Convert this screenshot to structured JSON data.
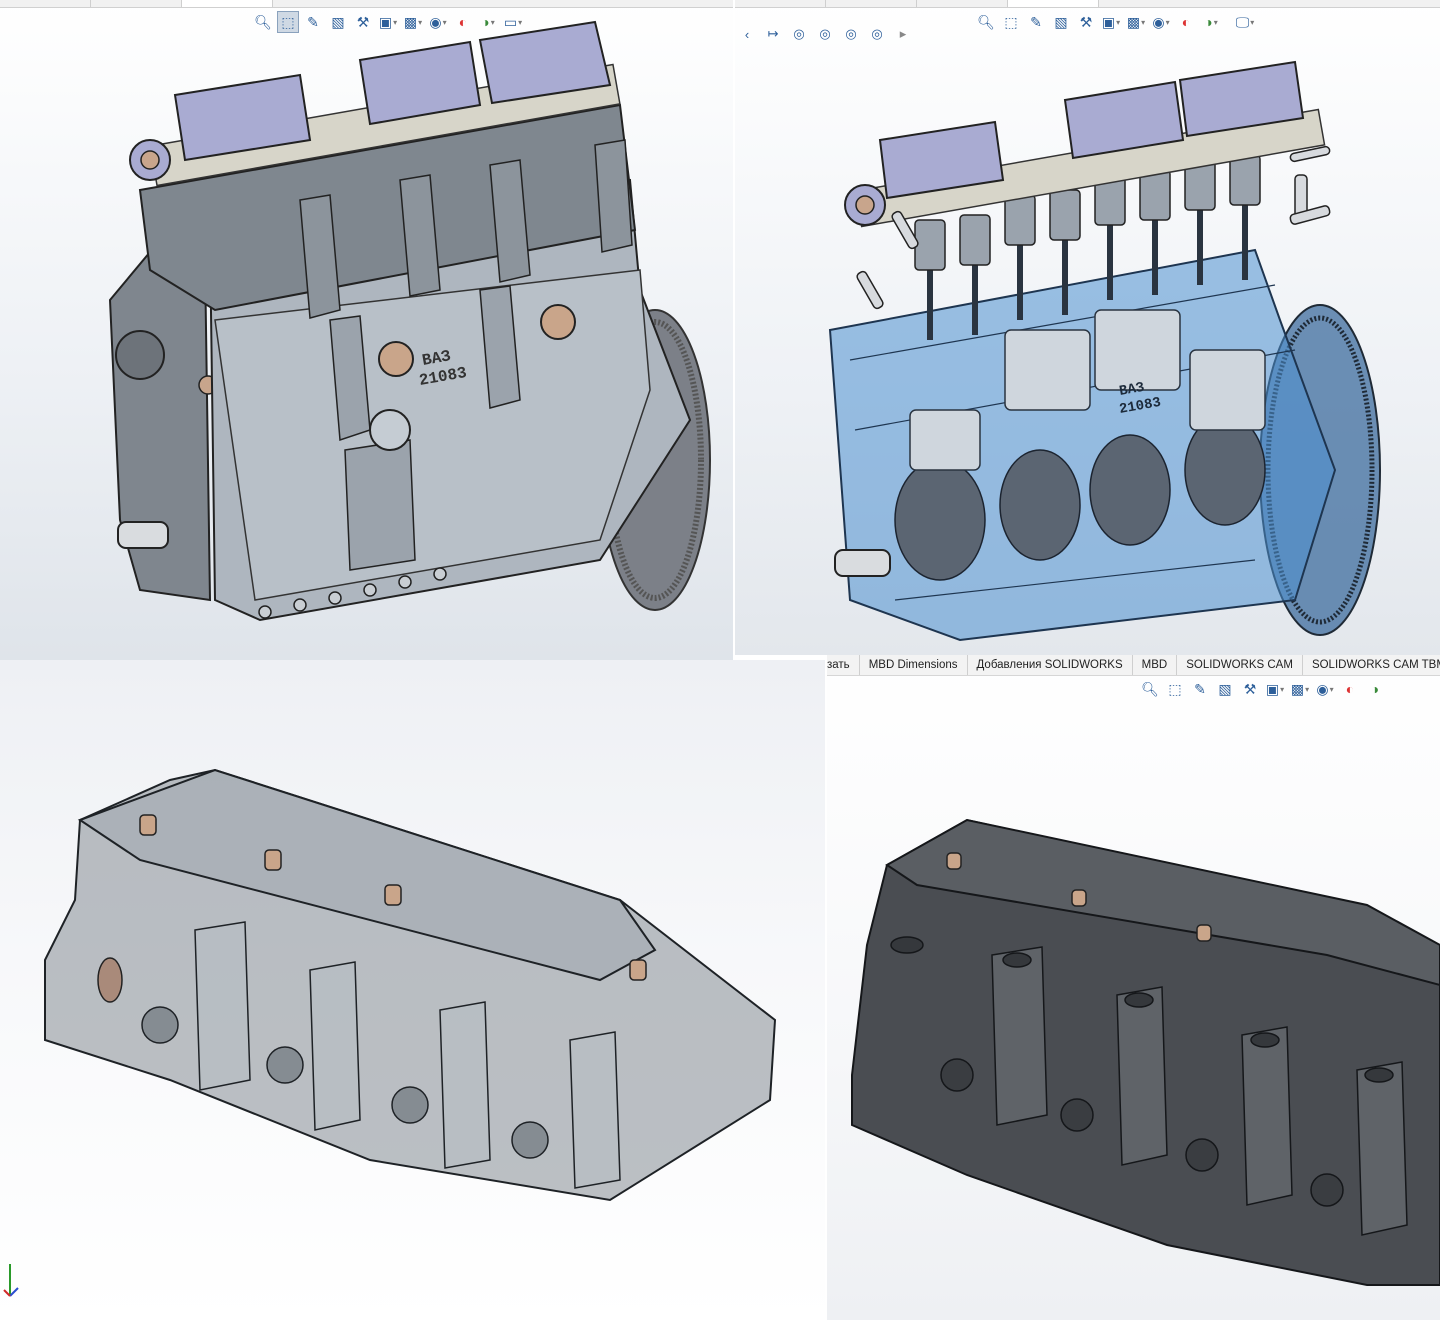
{
  "viewports": {
    "top_left": {
      "toolbar_icons": [
        "zoom-to-fit-icon",
        "zoom-area-icon",
        "previous-view-icon",
        "section-view-icon",
        "dynamic-annotation-icon",
        "view-orientation-icon",
        "display-style-icon",
        "hide-show-icon",
        "edit-appearance-icon",
        "apply-scene-icon",
        "view-settings-icon"
      ],
      "engraving": {
        "line1": "ВАЗ",
        "line2": "21083"
      }
    },
    "top_right": {
      "toolbar_icons": [
        "zoom-to-fit-icon",
        "zoom-area-icon",
        "previous-view-icon",
        "section-view-icon",
        "dynamic-annotation-icon",
        "view-orientation-icon",
        "display-style-icon",
        "hide-show-icon",
        "edit-appearance-icon",
        "apply-scene-icon",
        "view-settings-icon"
      ],
      "sketch_icons": [
        "dimension-icon",
        "horizontal-dimension-icon",
        "circle-icon",
        "concentric-icon",
        "concentric-icon",
        "concentric-icon"
      ],
      "engraving": {
        "line1": "ВАЗ",
        "line2": "21083"
      }
    },
    "bottom_right": {
      "command_tabs": [
        {
          "label": "зать",
          "cut": true
        },
        {
          "label": "MBD Dimensions"
        },
        {
          "label": "Добавления SOLIDWORKS"
        },
        {
          "label": "MBD"
        },
        {
          "label": "SOLIDWORKS CAM"
        },
        {
          "label": "SOLIDWORKS CAM TBM"
        }
      ],
      "toolbar_icons": [
        "zoom-to-fit-icon",
        "zoom-area-icon",
        "previous-view-icon",
        "section-view-icon",
        "dynamic-annotation-icon",
        "view-orientation-icon",
        "display-style-icon",
        "hide-show-icon",
        "edit-appearance-icon",
        "apply-scene-icon"
      ]
    }
  },
  "colors": {
    "block_gray": "#8e969e",
    "block_light": "#aeb6bf",
    "head_lavender": "#a9abd2",
    "transparent_blue": "#4d8fd0",
    "dark_head": "#4a4d52",
    "accent_blue": "#2d5f9a"
  }
}
